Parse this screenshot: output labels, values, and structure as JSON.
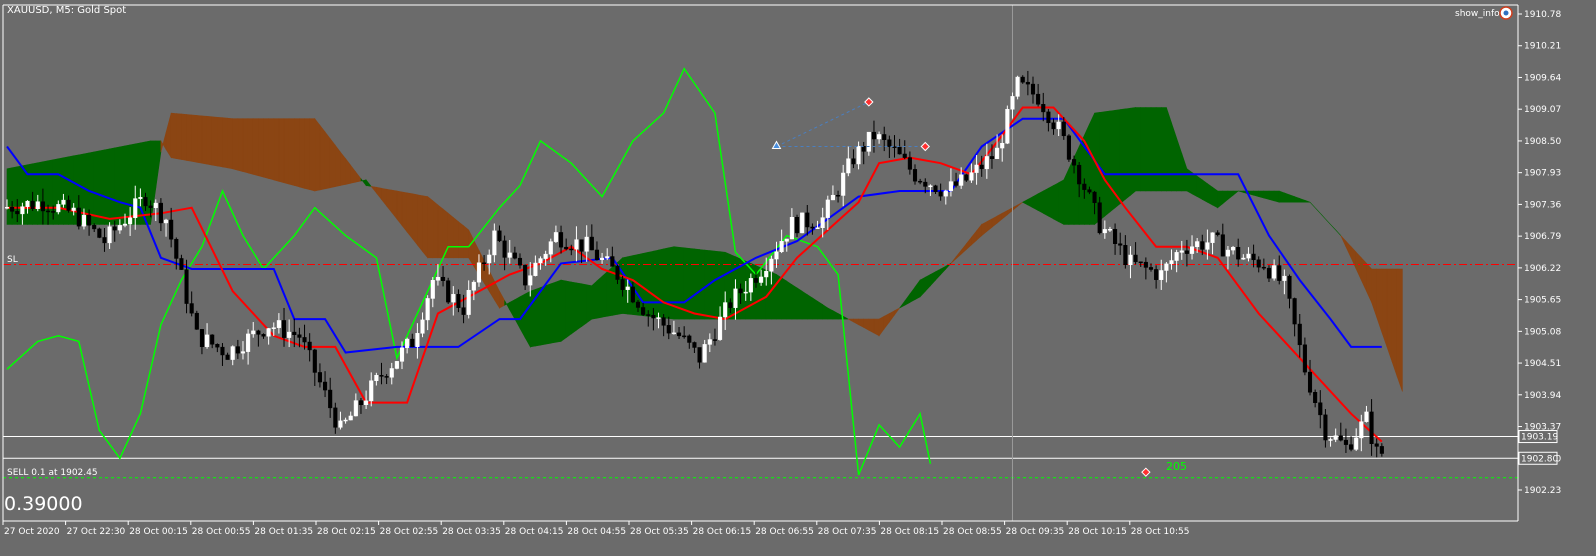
{
  "window": {
    "symbol_title": "XAUUSD, M5:  Gold Spot",
    "show_info_label": "show_info",
    "show_info_icon": "eye-icon"
  },
  "colors": {
    "background": "#6b6b6b",
    "candle_up": "#ffffff",
    "candle_down": "#000000",
    "kijun": "#0000ff",
    "tenkan": "#ff0000",
    "chikou": "#00ff00",
    "cloud_bull": "#006400",
    "cloud_bear": "#8b4513",
    "price_line": "#ffffff",
    "sl_line": "#ff0000",
    "entry_line": "#00ff00"
  },
  "chart_data": {
    "type": "candlestick",
    "title": "XAUUSD, M5:  Gold Spot",
    "ylim": [
      1902.0,
      1910.95
    ],
    "y_ticks": [
      "1910.78",
      "1910.21",
      "1909.64",
      "1909.07",
      "1908.50",
      "1907.93",
      "1907.36",
      "1906.79",
      "1906.22",
      "1905.65",
      "1905.08",
      "1904.51",
      "1903.94",
      "1903.37",
      "1902.80",
      "1902.23"
    ],
    "x_ticks": [
      "27 Oct 2020",
      "27 Oct 22:30",
      "28 Oct 00:15",
      "28 Oct 00:55",
      "28 Oct 01:35",
      "28 Oct 02:15",
      "28 Oct 02:55",
      "28 Oct 03:35",
      "28 Oct 04:15",
      "28 Oct 04:55",
      "28 Oct 05:35",
      "28 Oct 06:15",
      "28 Oct 06:55",
      "28 Oct 07:35",
      "28 Oct 08:15",
      "28 Oct 08:55",
      "28 Oct 09:35",
      "28 Oct 10:15",
      "28 Oct 10:55"
    ],
    "bar_count": 184,
    "ohlc_anchors": [
      [
        0,
        1907.3
      ],
      [
        8,
        1907.4
      ],
      [
        14,
        1907.2
      ],
      [
        20,
        1906.7
      ],
      [
        28,
        1907.5
      ],
      [
        32,
        1907.1
      ],
      [
        38,
        1905.0
      ],
      [
        44,
        1904.7
      ],
      [
        52,
        1905.2
      ],
      [
        58,
        1905.0
      ],
      [
        66,
        1903.3
      ],
      [
        74,
        1904.3
      ],
      [
        80,
        1904.9
      ],
      [
        84,
        1906.0
      ],
      [
        90,
        1905.5
      ],
      [
        96,
        1906.8
      ],
      [
        102,
        1906.0
      ],
      [
        108,
        1906.8
      ],
      [
        114,
        1906.6
      ],
      [
        120,
        1906.1
      ],
      [
        126,
        1905.4
      ],
      [
        132,
        1905.0
      ],
      [
        136,
        1904.6
      ],
      [
        142,
        1905.6
      ],
      [
        148,
        1906.2
      ],
      [
        154,
        1907.0
      ],
      [
        160,
        1907.1
      ],
      [
        166,
        1908.2
      ],
      [
        170,
        1908.6
      ],
      [
        174,
        1908.3
      ],
      [
        178,
        1907.9
      ],
      [
        184,
        1907.6
      ],
      [
        188,
        1907.8
      ],
      [
        194,
        1908.3
      ],
      [
        198,
        1909.5
      ],
      [
        202,
        1909.3
      ],
      [
        206,
        1908.7
      ],
      [
        210,
        1907.9
      ],
      [
        214,
        1907.0
      ],
      [
        220,
        1906.3
      ],
      [
        226,
        1906.1
      ],
      [
        230,
        1906.6
      ],
      [
        236,
        1906.7
      ],
      [
        242,
        1906.4
      ],
      [
        246,
        1906.3
      ],
      [
        250,
        1905.9
      ],
      [
        254,
        1904.4
      ],
      [
        258,
        1903.3
      ],
      [
        262,
        1903.0
      ],
      [
        266,
        1903.5
      ],
      [
        268,
        1902.9
      ]
    ],
    "tenkan": [
      [
        0,
        1907.3
      ],
      [
        10,
        1907.3
      ],
      [
        20,
        1907.1
      ],
      [
        30,
        1907.2
      ],
      [
        36,
        1907.3
      ],
      [
        44,
        1905.8
      ],
      [
        52,
        1905.0
      ],
      [
        58,
        1904.8
      ],
      [
        64,
        1904.8
      ],
      [
        70,
        1903.8
      ],
      [
        78,
        1903.8
      ],
      [
        84,
        1905.4
      ],
      [
        92,
        1905.8
      ],
      [
        98,
        1906.1
      ],
      [
        104,
        1906.3
      ],
      [
        110,
        1906.6
      ],
      [
        116,
        1906.2
      ],
      [
        122,
        1906.0
      ],
      [
        128,
        1905.6
      ],
      [
        134,
        1905.4
      ],
      [
        140,
        1905.3
      ],
      [
        148,
        1905.7
      ],
      [
        154,
        1906.4
      ],
      [
        160,
        1906.9
      ],
      [
        166,
        1907.4
      ],
      [
        170,
        1908.1
      ],
      [
        176,
        1908.2
      ],
      [
        182,
        1908.1
      ],
      [
        188,
        1907.9
      ],
      [
        194,
        1908.6
      ],
      [
        198,
        1909.1
      ],
      [
        204,
        1909.1
      ],
      [
        210,
        1908.5
      ],
      [
        214,
        1907.8
      ],
      [
        218,
        1907.3
      ],
      [
        224,
        1906.6
      ],
      [
        230,
        1906.6
      ],
      [
        236,
        1906.4
      ],
      [
        244,
        1905.4
      ],
      [
        250,
        1904.8
      ],
      [
        256,
        1904.2
      ],
      [
        262,
        1903.6
      ],
      [
        268,
        1903.1
      ]
    ],
    "kijun": [
      [
        0,
        1908.4
      ],
      [
        4,
        1907.9
      ],
      [
        10,
        1907.9
      ],
      [
        16,
        1907.6
      ],
      [
        22,
        1907.4
      ],
      [
        26,
        1907.3
      ],
      [
        30,
        1906.4
      ],
      [
        36,
        1906.2
      ],
      [
        46,
        1906.2
      ],
      [
        52,
        1906.2
      ],
      [
        56,
        1905.3
      ],
      [
        62,
        1905.3
      ],
      [
        66,
        1904.7
      ],
      [
        76,
        1904.8
      ],
      [
        88,
        1904.8
      ],
      [
        96,
        1905.3
      ],
      [
        100,
        1905.3
      ],
      [
        108,
        1906.3
      ],
      [
        118,
        1906.4
      ],
      [
        124,
        1905.6
      ],
      [
        132,
        1905.6
      ],
      [
        138,
        1906.0
      ],
      [
        146,
        1906.4
      ],
      [
        154,
        1906.7
      ],
      [
        160,
        1907.1
      ],
      [
        166,
        1907.5
      ],
      [
        174,
        1907.6
      ],
      [
        184,
        1907.6
      ],
      [
        190,
        1908.4
      ],
      [
        198,
        1908.9
      ],
      [
        206,
        1908.9
      ],
      [
        214,
        1907.9
      ],
      [
        228,
        1907.9
      ],
      [
        240,
        1907.9
      ],
      [
        246,
        1906.8
      ],
      [
        252,
        1906.0
      ],
      [
        258,
        1905.3
      ],
      [
        262,
        1904.8
      ],
      [
        268,
        1904.8
      ]
    ],
    "chikou": [
      [
        0,
        1904.4
      ],
      [
        6,
        1904.9
      ],
      [
        10,
        1905.0
      ],
      [
        14,
        1904.9
      ],
      [
        18,
        1903.3
      ],
      [
        22,
        1902.8
      ],
      [
        26,
        1903.6
      ],
      [
        30,
        1905.2
      ],
      [
        34,
        1906.0
      ],
      [
        38,
        1906.6
      ],
      [
        42,
        1907.6
      ],
      [
        46,
        1906.8
      ],
      [
        50,
        1906.2
      ],
      [
        56,
        1906.8
      ],
      [
        60,
        1907.3
      ],
      [
        66,
        1906.8
      ],
      [
        72,
        1906.4
      ],
      [
        76,
        1904.6
      ],
      [
        80,
        1905.4
      ],
      [
        86,
        1906.6
      ],
      [
        90,
        1906.6
      ],
      [
        96,
        1907.3
      ],
      [
        100,
        1907.7
      ],
      [
        104,
        1908.5
      ],
      [
        110,
        1908.1
      ],
      [
        116,
        1907.5
      ],
      [
        122,
        1908.5
      ],
      [
        128,
        1909.0
      ],
      [
        132,
        1909.8
      ],
      [
        138,
        1909.0
      ],
      [
        142,
        1906.5
      ],
      [
        146,
        1906.1
      ],
      [
        152,
        1906.8
      ],
      [
        158,
        1906.6
      ],
      [
        162,
        1906.1
      ],
      [
        166,
        1902.5
      ],
      [
        170,
        1903.4
      ],
      [
        174,
        1903.0
      ],
      [
        178,
        1903.6
      ],
      [
        180,
        1902.7
      ]
    ],
    "senkou_a": [
      [
        0,
        1908.0
      ],
      [
        28,
        1908.5
      ],
      [
        30,
        1908.5
      ],
      [
        32,
        1908.2
      ],
      [
        44,
        1908.0
      ],
      [
        60,
        1907.6
      ],
      [
        70,
        1907.8
      ],
      [
        82,
        1906.4
      ],
      [
        90,
        1906.4
      ],
      [
        96,
        1905.5
      ],
      [
        102,
        1905.8
      ],
      [
        108,
        1906.0
      ],
      [
        114,
        1905.9
      ],
      [
        120,
        1906.4
      ],
      [
        130,
        1906.6
      ],
      [
        140,
        1906.5
      ],
      [
        150,
        1906.1
      ],
      [
        160,
        1905.5
      ],
      [
        170,
        1905.0
      ],
      [
        178,
        1906.0
      ],
      [
        184,
        1906.3
      ],
      [
        190,
        1906.8
      ],
      [
        198,
        1907.4
      ],
      [
        206,
        1907.8
      ],
      [
        212,
        1909.0
      ],
      [
        220,
        1909.1
      ],
      [
        226,
        1909.1
      ],
      [
        230,
        1908.0
      ],
      [
        236,
        1907.6
      ],
      [
        240,
        1907.6
      ],
      [
        248,
        1907.6
      ],
      [
        254,
        1907.4
      ],
      [
        260,
        1906.8
      ],
      [
        266,
        1905.6
      ],
      [
        272,
        1904.0
      ]
    ],
    "senkou_b": [
      [
        0,
        1907.0
      ],
      [
        28,
        1907.0
      ],
      [
        30,
        1908.3
      ],
      [
        32,
        1909.0
      ],
      [
        44,
        1908.9
      ],
      [
        60,
        1908.9
      ],
      [
        70,
        1907.7
      ],
      [
        82,
        1907.5
      ],
      [
        90,
        1906.9
      ],
      [
        96,
        1905.8
      ],
      [
        102,
        1904.8
      ],
      [
        108,
        1904.9
      ],
      [
        114,
        1905.3
      ],
      [
        120,
        1905.4
      ],
      [
        130,
        1905.3
      ],
      [
        140,
        1905.3
      ],
      [
        150,
        1905.3
      ],
      [
        160,
        1905.3
      ],
      [
        170,
        1905.3
      ],
      [
        178,
        1905.7
      ],
      [
        184,
        1906.3
      ],
      [
        190,
        1907.0
      ],
      [
        198,
        1907.4
      ],
      [
        206,
        1907.0
      ],
      [
        212,
        1907.0
      ],
      [
        220,
        1907.6
      ],
      [
        226,
        1907.6
      ],
      [
        230,
        1907.6
      ],
      [
        236,
        1907.3
      ],
      [
        240,
        1907.6
      ],
      [
        248,
        1907.4
      ],
      [
        254,
        1907.4
      ],
      [
        260,
        1906.8
      ],
      [
        266,
        1906.2
      ],
      [
        272,
        1906.2
      ]
    ],
    "horizontal_lines": [
      {
        "name": "price-line-upper",
        "price": 1903.19,
        "label": "1903.19"
      },
      {
        "name": "price-line-lower",
        "price": 1902.8,
        "label": "1902.80"
      }
    ],
    "stop_loss": {
      "price": 1906.28,
      "label": "SL"
    },
    "sell_entry": {
      "price": 1902.45,
      "label": "SELL 0.1 at 1902.45"
    },
    "spread_label": "205",
    "bottom_left_value": "0.39000",
    "crosshair_bar": 196
  }
}
